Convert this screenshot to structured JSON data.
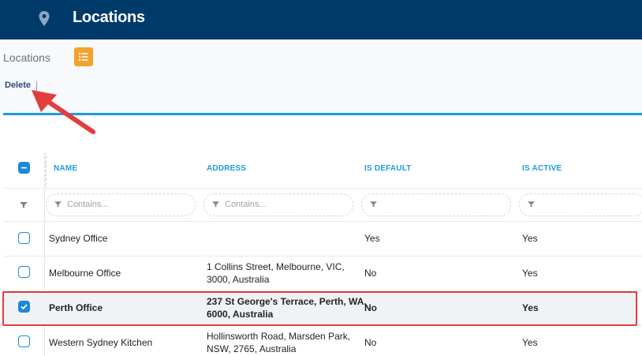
{
  "header": {
    "title": "Locations",
    "icon": "map-pin-icon"
  },
  "subheader": {
    "breadcrumb": "Locations",
    "list_icon": "list-icon"
  },
  "toolbar": {
    "delete_label": "Delete"
  },
  "grid": {
    "columns": [
      "NAME",
      "ADDRESS",
      "IS DEFAULT",
      "IS ACTIVE"
    ],
    "filters": {
      "name_placeholder": "Contains...",
      "address_placeholder": "Contains...",
      "is_default_placeholder": "",
      "is_active_placeholder": ""
    },
    "rows": [
      {
        "checked": false,
        "name": "Sydney Office",
        "address_line1": "",
        "address_line2": "",
        "is_default": "Yes",
        "is_active": "Yes"
      },
      {
        "checked": false,
        "name": "Melbourne Office",
        "address_line1": "1 Collins Street, Melbourne, VIC,",
        "address_line2": "3000, Australia",
        "is_default": "No",
        "is_active": "Yes"
      },
      {
        "checked": true,
        "name": "Perth Office",
        "address_line1": "237 St George's Terrace, Perth, WA,",
        "address_line2": "6000, Australia",
        "is_default": "No",
        "is_active": "Yes"
      },
      {
        "checked": false,
        "name": "Western Sydney Kitchen",
        "address_line1": "Hollinsworth Road, Marsden Park,",
        "address_line2": "NSW, 2765, Australia",
        "is_default": "No",
        "is_active": "Yes"
      }
    ]
  },
  "colors": {
    "header_bg": "#003a6b",
    "accent_blue": "#1e9be0",
    "checkbox_blue": "#1e88d8",
    "list_button": "#f2a32d",
    "annotation_red": "#e23d3d"
  }
}
